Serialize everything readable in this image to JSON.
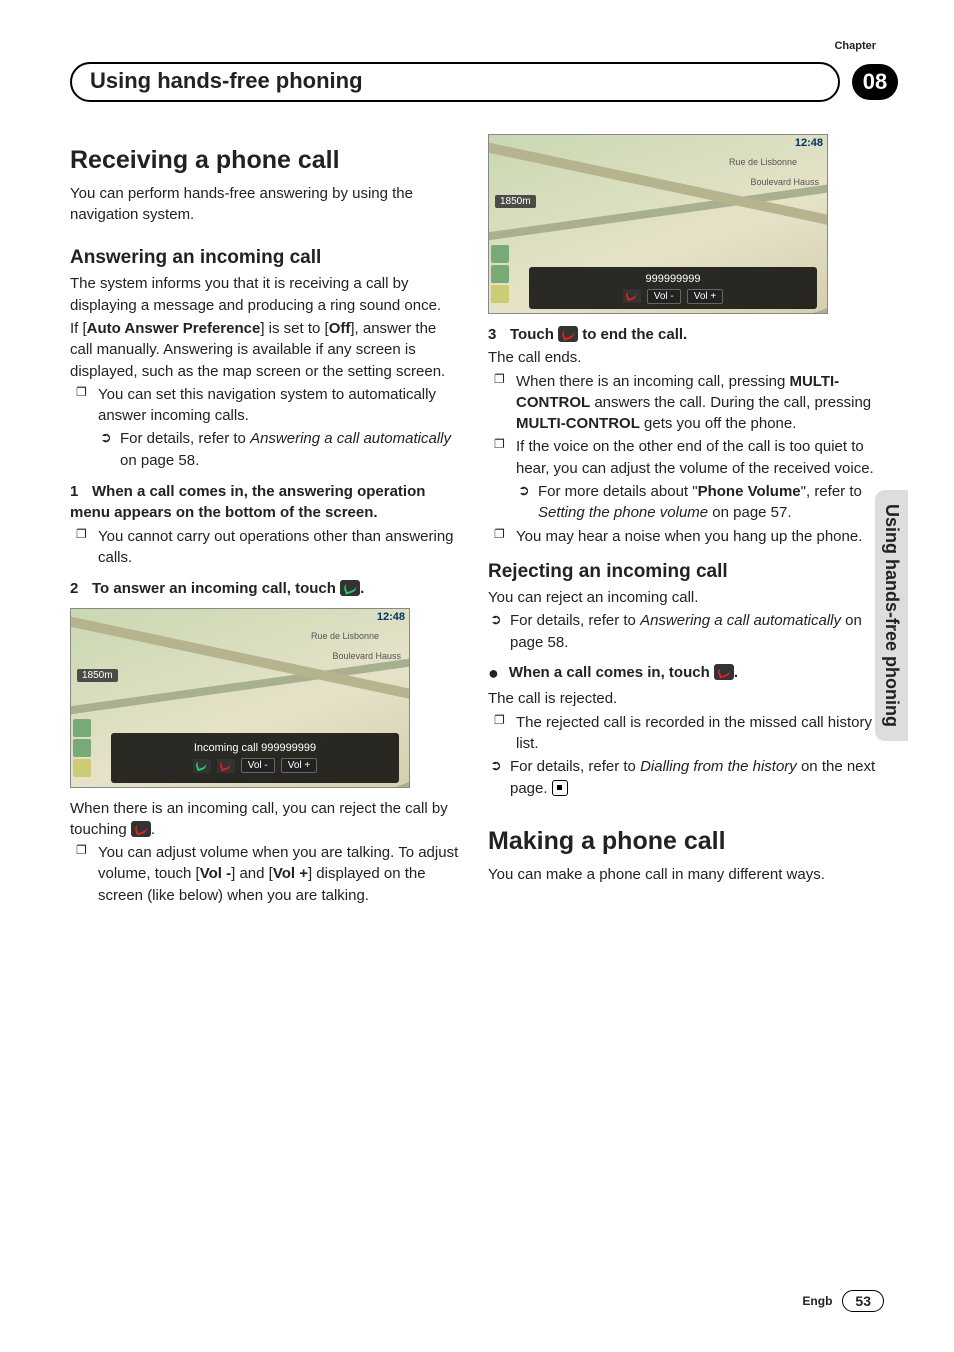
{
  "header": {
    "chapter_label": "Chapter",
    "title": "Using hands-free phoning",
    "chapter_number": "08"
  },
  "side_tab": "Using hands-free phoning",
  "left": {
    "h1": "Receiving a phone call",
    "p1": "You can perform hands-free answering by using the navigation system.",
    "sub1": "Answering an incoming call",
    "p2": "The system informs you that it is receiving a call by displaying a message and producing a ring sound once.",
    "p3a": "If [",
    "p3b": "Auto Answer Preference",
    "p3c": "] is set to [",
    "p3d": "Off",
    "p3e": "], answer the call manually. Answering is available if any screen is displayed, such as the map screen or the setting screen.",
    "b1": "You can set this navigation system to automatically answer incoming calls.",
    "b1a_a": "For details, refer to ",
    "b1a_b": "Answering a call automatically",
    "b1a_c": " on page 58.",
    "step1": "When a call comes in, the answering operation menu appears on the bottom of the screen.",
    "step1b": "You cannot carry out operations other than answering calls.",
    "step2": "To answer an incoming call, touch ",
    "step2end": ".",
    "map1_overlay": "Incoming call  999999999",
    "p_reject": "When there is an incoming call, you can reject the call by touching ",
    "p_reject_end": ".",
    "vol_a": "You can adjust volume when you are talking. To adjust volume, touch [",
    "vol_b": "Vol -",
    "vol_c": "] and [",
    "vol_d": "Vol +",
    "vol_e": "] displayed on the screen (like below) when you are talking."
  },
  "map_common": {
    "time": "12:48",
    "dist": "1850m",
    "street1": "Rue de Lisbonne",
    "street2": "Boulevard Hauss",
    "volminus": "Vol -",
    "volplus": "Vol +"
  },
  "right": {
    "map2_overlay": "999999999",
    "step3": "Touch ",
    "step3end": " to end the call.",
    "p_end": "The call ends.",
    "b2a": "When there is an incoming call,  pressing ",
    "b2b": "MULTI-CONTROL",
    "b2c": " answers the call. During the call, pressing ",
    "b2d": "MULTI-CONTROL",
    "b2e": " gets you off the phone.",
    "b3": "If the voice on the other end of the call is too quiet to hear, you can adjust the volume of the received voice.",
    "b3a_a": "For more details about \"",
    "b3a_b": "Phone Volume",
    "b3a_c": "\", refer to ",
    "b3a_d": "Setting the phone volume",
    "b3a_e": " on page 57.",
    "b4": "You may hear a noise when you hang up the phone.",
    "sub2": "Rejecting an incoming call",
    "p4": "You can reject an incoming call.",
    "p4a_a": "For details, refer to ",
    "p4a_b": "Answering a call automatically",
    "p4a_c": " on page 58.",
    "dot1": "When a call comes in, touch ",
    "dot1end": ".",
    "p5": "The call is rejected.",
    "b5": "The rejected call is recorded in the missed call history list.",
    "b5a_a": "For details, refer to ",
    "b5a_b": "Dialling from the history",
    "b5a_c": " on the next page.",
    "h2": "Making a phone call",
    "p6": "You can make a phone call in many different ways."
  },
  "footer": {
    "lang": "Engb",
    "page": "53"
  }
}
